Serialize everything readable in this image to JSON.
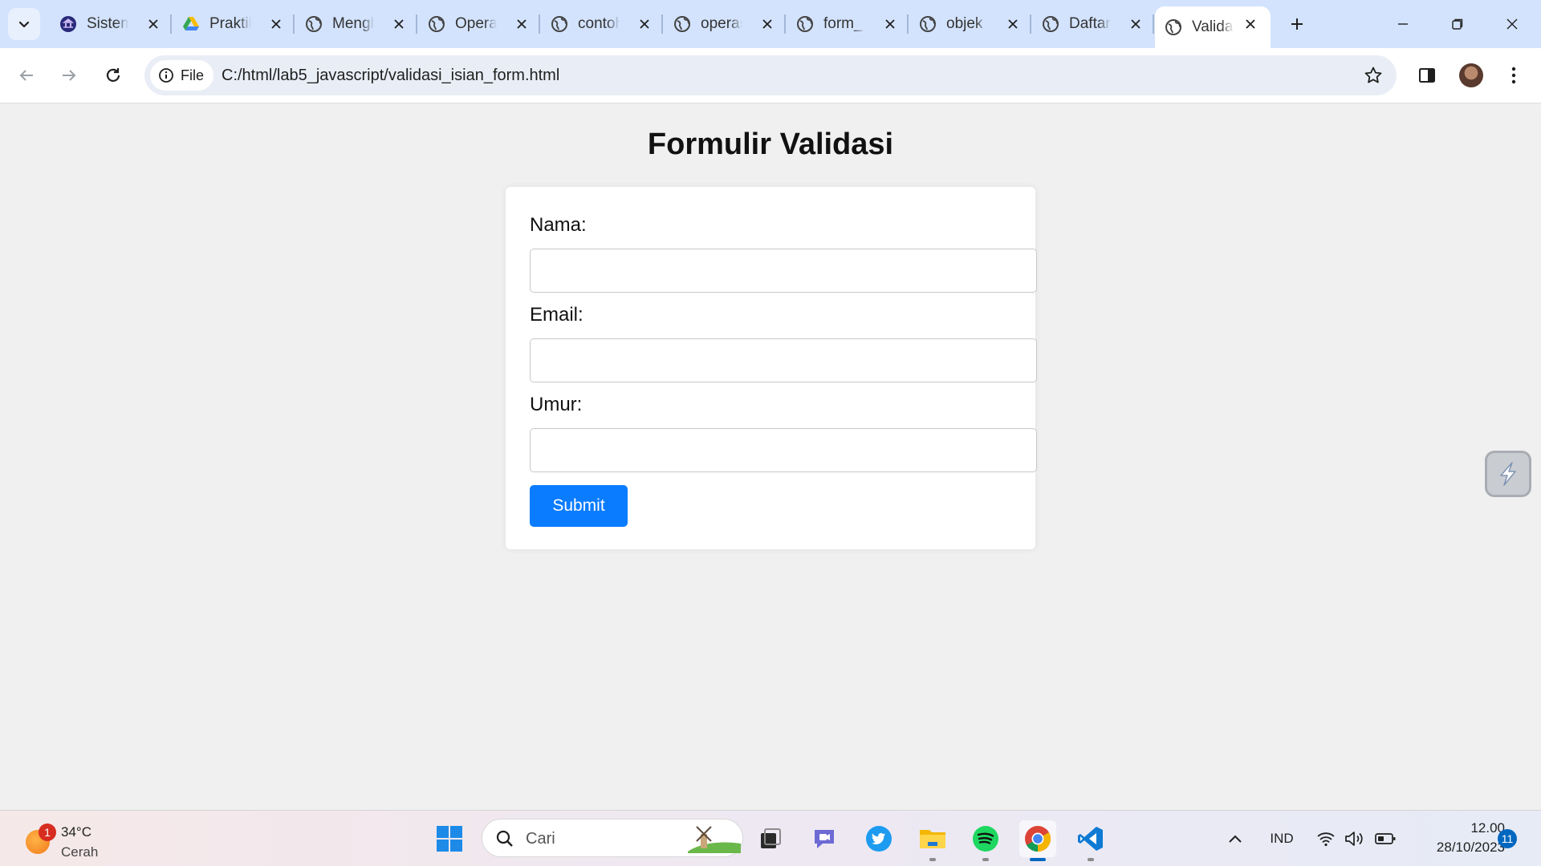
{
  "browser": {
    "tabs": [
      {
        "title": "Sistem",
        "favicon": "university-icon"
      },
      {
        "title": "Praktikum",
        "favicon": "google-drive-icon"
      },
      {
        "title": "Menghitung",
        "favicon": "globe-icon"
      },
      {
        "title": "Operator",
        "favicon": "globe-icon"
      },
      {
        "title": "contoh",
        "favicon": "globe-icon"
      },
      {
        "title": "operasi",
        "favicon": "globe-icon"
      },
      {
        "title": "form_",
        "favicon": "globe-icon"
      },
      {
        "title": "objek",
        "favicon": "globe-icon"
      },
      {
        "title": "Daftar",
        "favicon": "globe-icon"
      },
      {
        "title": "Validasi",
        "favicon": "globe-icon",
        "active": true
      }
    ],
    "site_chip_label": "File",
    "url": "C:/html/lab5_javascript/validasi_isian_form.html",
    "colors": {
      "tabstrip": "#d3e3fd",
      "toolbar": "#ffffff",
      "omnibox": "#e9eef6"
    }
  },
  "page": {
    "title": "Formulir Validasi",
    "fields": [
      {
        "label": "Nama:",
        "value": "",
        "type": "text"
      },
      {
        "label": "Email:",
        "value": "",
        "type": "email"
      },
      {
        "label": "Umur:",
        "value": "",
        "type": "number"
      }
    ],
    "submit_label": "Submit",
    "colors": {
      "background": "#f0f0f0",
      "card": "#ffffff",
      "button": "#0a7cff"
    }
  },
  "taskbar": {
    "weather": {
      "temp": "34°C",
      "condition": "Cerah",
      "badge": "1"
    },
    "search_placeholder": "Cari",
    "apps": [
      "windows-start-icon",
      "search",
      "task-view-icon",
      "teams-chat-icon",
      "twitter-icon",
      "file-explorer-icon",
      "spotify-icon",
      "chrome-icon",
      "vscode-icon"
    ],
    "language": "IND",
    "time": "12.00",
    "date": "28/10/2023",
    "notification_count": "11"
  }
}
